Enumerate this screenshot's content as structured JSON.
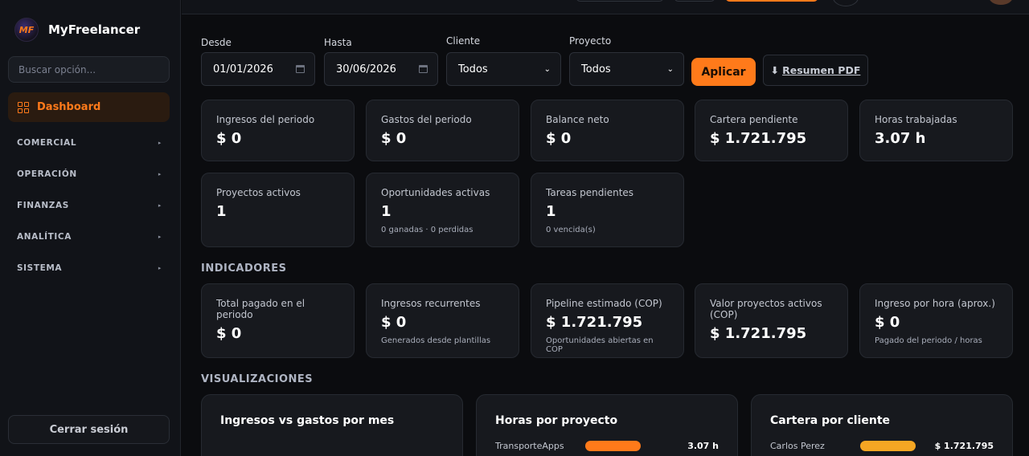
{
  "app": {
    "name": "MyFreelancer",
    "logo_text": "MF"
  },
  "sidebar": {
    "search_placeholder": "Buscar opción...",
    "active": "Dashboard",
    "sections": [
      "COMERCIAL",
      "OPERACIÓN",
      "FINANZAS",
      "ANALÍTICA",
      "SISTEMA"
    ],
    "logout": "Cerrar sesión"
  },
  "filters": {
    "desde_label": "Desde",
    "desde_value": "01/01/2026",
    "hasta_label": "Hasta",
    "hasta_value": "30/06/2026",
    "cliente_label": "Cliente",
    "cliente_value": "Todos",
    "proyecto_label": "Proyecto",
    "proyecto_value": "Todos",
    "apply": "Aplicar",
    "pdf_icon": "⬇",
    "pdf": "Resumen PDF"
  },
  "stats": [
    {
      "title": "Ingresos del periodo",
      "value": "$ 0"
    },
    {
      "title": "Gastos del periodo",
      "value": "$ 0"
    },
    {
      "title": "Balance neto",
      "value": "$ 0"
    },
    {
      "title": "Cartera pendiente",
      "value": "$ 1.721.795"
    },
    {
      "title": "Horas trabajadas",
      "value": "3.07 h"
    },
    {
      "title": "Proyectos activos",
      "value": "1"
    },
    {
      "title": "Oportunidades activas",
      "value": "1",
      "sub": "0 ganadas · 0 perdidas"
    },
    {
      "title": "Tareas pendientes",
      "value": "1",
      "sub": "0 vencida(s)"
    }
  ],
  "indicadores_title": "INDICADORES",
  "indicadores": [
    {
      "title": "Total pagado en el periodo",
      "value": "$ 0"
    },
    {
      "title": "Ingresos recurrentes",
      "value": "$ 0",
      "sub": "Generados desde plantillas"
    },
    {
      "title": "Pipeline estimado (COP)",
      "value": "$ 1.721.795",
      "sub": "Oportunidades abiertas en COP"
    },
    {
      "title": "Valor proyectos activos (COP)",
      "value": "$ 1.721.795"
    },
    {
      "title": "Ingreso por hora (aprox.)",
      "value": "$ 0",
      "sub": "Pagado del periodo / horas"
    }
  ],
  "visualizaciones_title": "VISUALIZACIONES",
  "charts": [
    {
      "title": "Ingresos vs gastos por mes"
    },
    {
      "title": "Horas por proyecto",
      "row_name": "TransporteApps",
      "row_value": "3.07 h",
      "bar_color": "#ff7a1a"
    },
    {
      "title": "Cartera por cliente",
      "row_name": "Carlos Perez",
      "row_value": "$ 1.721.795",
      "bar_color": "#f5a623"
    }
  ],
  "colors": {
    "accent": "#ff7a1a",
    "background": "#0b0c0f",
    "card": "#17191e"
  }
}
